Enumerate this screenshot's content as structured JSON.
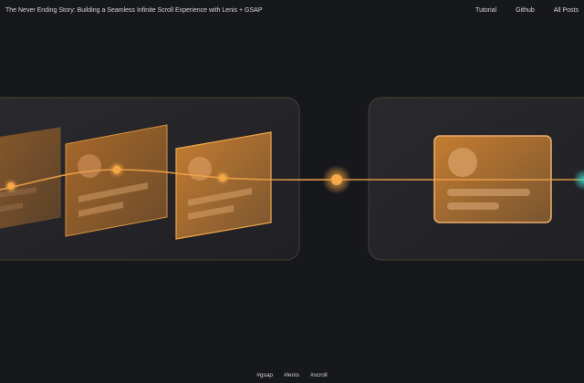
{
  "header": {
    "title": "The Never Ending Story: Building a Seamless Infinite Scroll Experience with Lenis + GSAP",
    "nav": [
      "Tutorial",
      "Github",
      "All Posts"
    ]
  },
  "footer": {
    "tags": [
      "#gsap",
      "#lenis",
      "#scroll"
    ]
  },
  "colors": {
    "background": "#17181b",
    "accent": "#f5a03a",
    "teal_glow": "#3fd6c8"
  }
}
